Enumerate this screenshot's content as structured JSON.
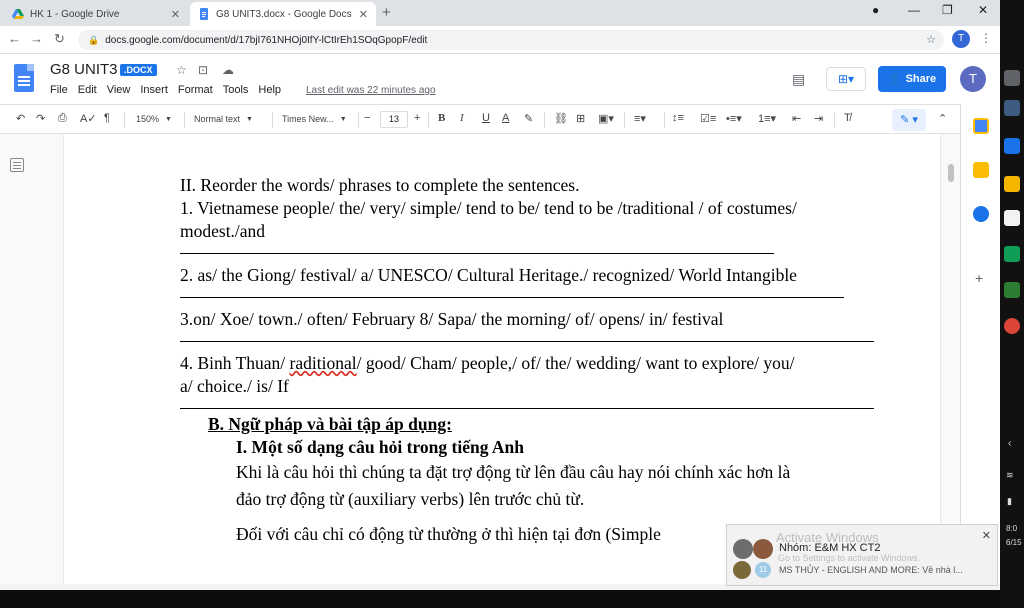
{
  "browser": {
    "tabs": [
      {
        "title": "HK 1 - Google Drive",
        "active": false
      },
      {
        "title": "G8 UNIT3.docx - Google Docs",
        "active": true
      }
    ],
    "url": "docs.google.com/document/d/17bjI761NHOj0IfY-lCtIrEh1SOqGpopF/edit",
    "profile_initial": "T"
  },
  "docs": {
    "title": "G8 UNIT3",
    "extension_badge": ".DOCX",
    "menu": [
      "File",
      "Edit",
      "View",
      "Insert",
      "Format",
      "Tools",
      "Help"
    ],
    "last_edit": "Last edit was 22 minutes ago",
    "share_label": "Share",
    "avatar_initial": "T",
    "toolbar": {
      "zoom": "150%",
      "style": "Normal text",
      "font": "Times New...",
      "font_size": "13"
    }
  },
  "document": {
    "section_heading": "II. Reorder the words/ phrases to complete the sentences.",
    "q1_line1": "1. Vietnamese people/ the/ very/ simple/ tend to be/ tend to be /traditional / of costumes/",
    "q1_line2": "modest./and",
    "q2": "2. as/ the Giong/ festival/ a/ UNESCO/ Cultural Heritage./ recognized/ World Intangible",
    "q3": "3.on/ Xoe/ town./ often/ February 8/ Sapa/ the morning/ of/ opens/ in/ festival",
    "q4_line1_a": "4. Binh Thuan/ ",
    "q4_line1_spell": "raditional",
    "q4_line1_b": "/ good/ Cham/ people,/ of/ the/ wedding/ want to explore/ you/",
    "q4_line2": "a/ choice./ is/ If",
    "heading_b": "B.  Ngữ pháp và bài tập áp dụng:",
    "heading_i": "I. Một số dạng câu hỏi trong tiếng Anh",
    "para1_line1": "Khi là câu hỏi thì chúng ta đặt trợ động từ lên đầu câu hay nói chính xác hơn là",
    "para1_line2": "đảo trợ động từ (auxiliary verbs) lên trước chủ từ.",
    "para2_line1": "Đối với câu chỉ có động từ thường ở thì hiện tại đơn (Simple"
  },
  "notification": {
    "title": "Nhóm: E&M HX CT2",
    "message": "MS THỦY - ENGLISH AND MORE: Về nhà l...",
    "count": "11"
  },
  "watermark": {
    "title": "Activate Windows",
    "subtitle": "Go to Settings to activate Windows."
  },
  "taskbar": {
    "time": "8:0",
    "date": "6/15"
  },
  "colors": {
    "accent": "#1a73e8",
    "docs_blue": "#4285f4"
  }
}
